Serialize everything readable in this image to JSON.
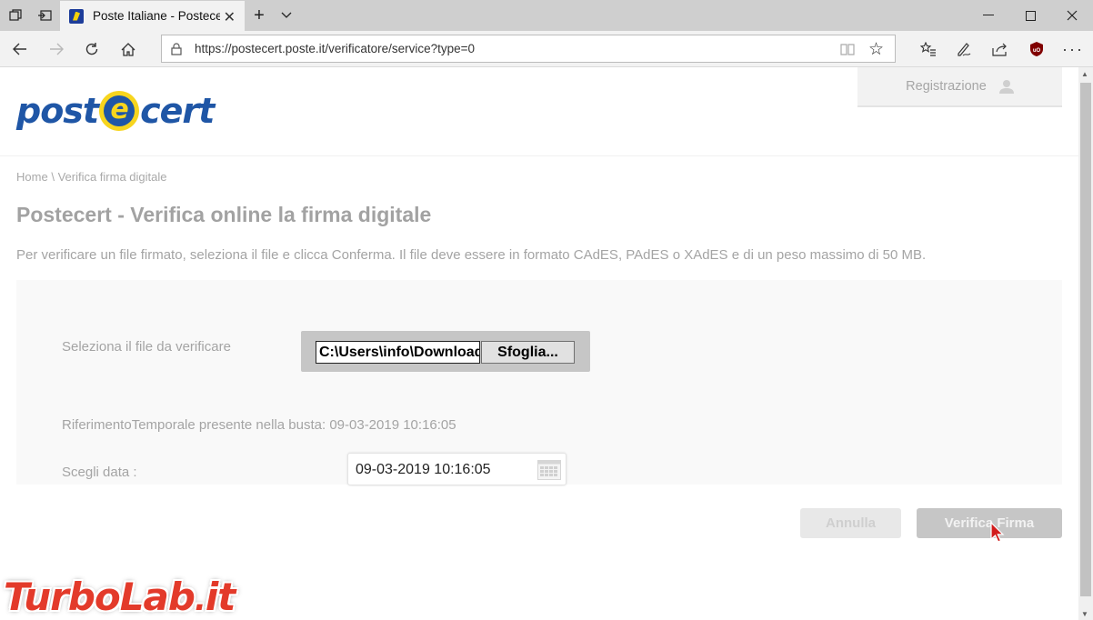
{
  "browser": {
    "tab_title": "Poste Italiane - Postecert",
    "url": "https://postecert.poste.it/verificatore/service?type=0",
    "new_tab_label": "+",
    "tab_list_label": "⌄"
  },
  "header": {
    "logo_text_left": "post",
    "logo_text_e": "e",
    "logo_text_right": "cert",
    "register_label": "Registrazione"
  },
  "breadcrumb": {
    "home": "Home",
    "separator": "\\",
    "current": "Verifica firma digitale"
  },
  "main": {
    "title": "Postecert - Verifica online la firma digitale",
    "intro": "Per verificare un file firmato, seleziona il file e clicca Conferma. Il file deve essere in formato CAdES, PAdES o XAdES e di un peso massimo di 50 MB."
  },
  "form": {
    "file_label": "Seleziona il file da verificare",
    "file_value": "C:\\Users\\info\\Downloads",
    "browse_label": "Sfoglia...",
    "reference_text": "RiferimentoTemporale presente nella busta: 09-03-2019 10:16:05",
    "date_label": "Scegli data :",
    "date_value": "09-03-2019 10:16:05"
  },
  "actions": {
    "cancel_label": "Annulla",
    "verify_label": "Verifica Firma"
  },
  "watermark": {
    "text_left": "TurboLab",
    "text_dot": ".",
    "text_right": "it"
  },
  "colors": {
    "brand_blue": "#1f56a6",
    "brand_yellow": "#f7d51e",
    "watermark_red": "#e33a2a"
  }
}
